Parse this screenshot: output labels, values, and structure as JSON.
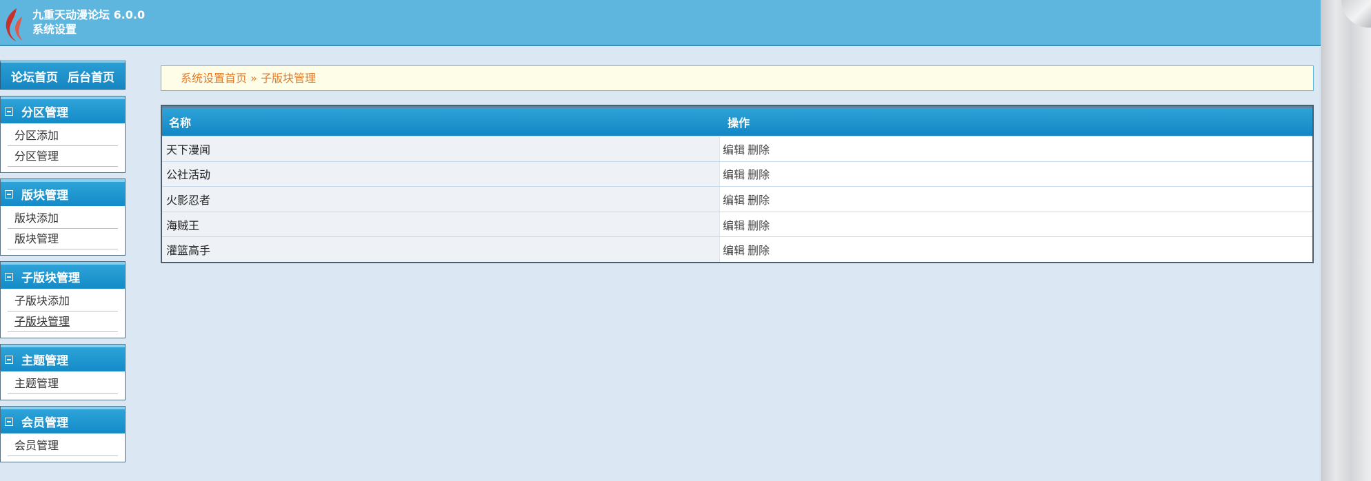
{
  "header": {
    "app_name": "九重天动漫论坛 6.0.0",
    "subtitle": "系统设置"
  },
  "sidebar": {
    "top_links": [
      "论坛首页",
      "后台首页"
    ],
    "groups": [
      {
        "title": "分区管理",
        "items": [
          "分区添加",
          "分区管理"
        ]
      },
      {
        "title": "版块管理",
        "items": [
          "版块添加",
          "版块管理"
        ]
      },
      {
        "title": "子版块管理",
        "items": [
          "子版块添加",
          "子版块管理"
        ]
      },
      {
        "title": "主题管理",
        "items": [
          "主题管理"
        ]
      },
      {
        "title": "会员管理",
        "items": [
          "会员管理"
        ]
      }
    ]
  },
  "breadcrumb": {
    "home": "系统设置首页",
    "separator": "»",
    "current": "子版块管理"
  },
  "table": {
    "columns": [
      "名称",
      "操作"
    ],
    "rows": [
      {
        "name": "天下漫闻",
        "edit": "编辑",
        "delete": "删除"
      },
      {
        "name": "公社活动",
        "edit": "编辑",
        "delete": "删除"
      },
      {
        "name": "火影忍者",
        "edit": "编辑",
        "delete": "删除"
      },
      {
        "name": "海贼王",
        "edit": "编辑",
        "delete": "删除"
      },
      {
        "name": "灌篮高手",
        "edit": "编辑",
        "delete": "删除"
      }
    ]
  },
  "colors": {
    "header_bg": "#5eb6df",
    "accent": "#148bc8",
    "breadcrumb_text": "#e27b2a"
  }
}
